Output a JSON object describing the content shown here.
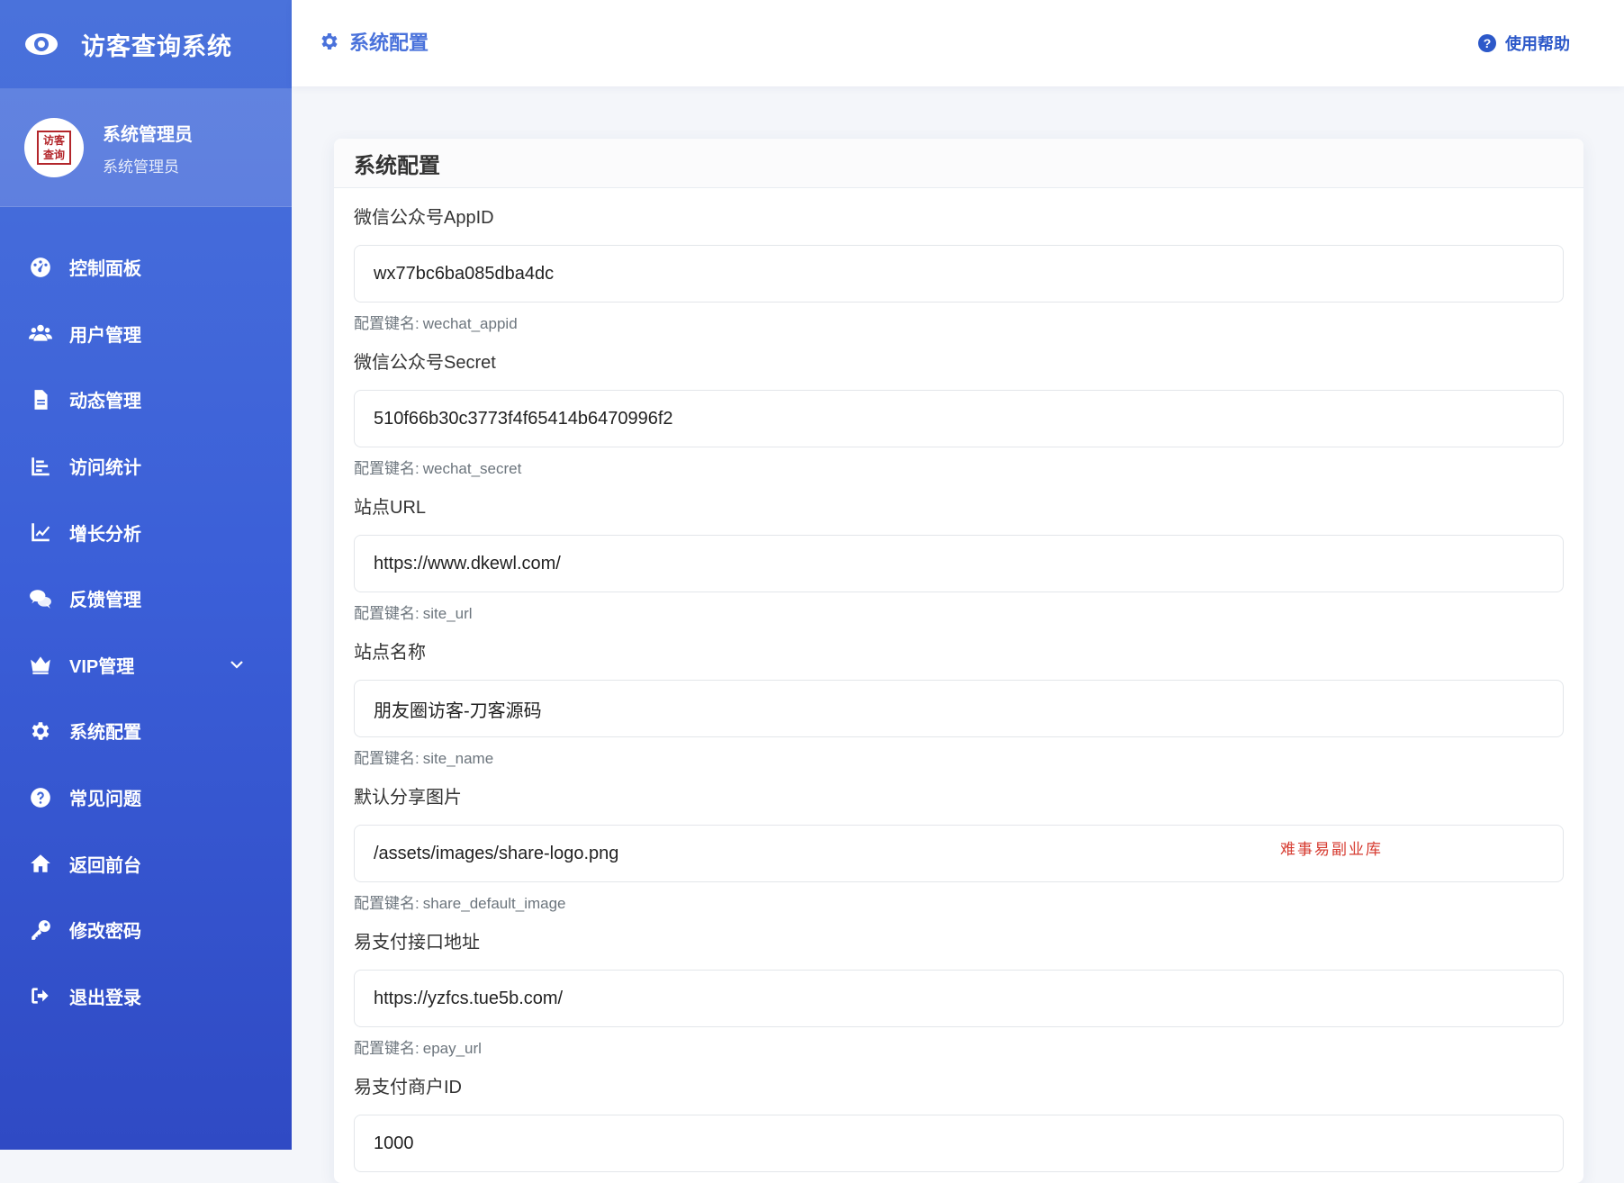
{
  "brand": {
    "title": "访客查询系统",
    "icon": "eye-icon"
  },
  "profile": {
    "name": "系统管理员",
    "role": "系统管理员",
    "avatar_text": [
      "访",
      "客",
      "查",
      "询"
    ]
  },
  "nav": [
    {
      "label": "控制面板",
      "icon": "dashboard-icon"
    },
    {
      "label": "用户管理",
      "icon": "users-icon"
    },
    {
      "label": "动态管理",
      "icon": "file-icon"
    },
    {
      "label": "访问统计",
      "icon": "bar-chart-icon"
    },
    {
      "label": "增长分析",
      "icon": "line-chart-icon"
    },
    {
      "label": "反馈管理",
      "icon": "comments-icon"
    },
    {
      "label": "VIP管理",
      "icon": "crown-icon"
    },
    {
      "label": "系统配置",
      "icon": "gear-icon"
    },
    {
      "label": "常见问题",
      "icon": "question-icon"
    },
    {
      "label": "返回前台",
      "icon": "home-icon"
    },
    {
      "label": "修改密码",
      "icon": "key-icon"
    },
    {
      "label": "退出登录",
      "icon": "logout-icon"
    }
  ],
  "topbar": {
    "title": "系统配置",
    "help_label": "使用帮助"
  },
  "card": {
    "title": "系统配置",
    "hint_prefix": "配置键名:",
    "watermark": "难事易副业库",
    "fields": [
      {
        "label": "微信公众号AppID",
        "value": "wx77bc6ba085dba4dc",
        "key": "wechat_appid"
      },
      {
        "label": "微信公众号Secret",
        "value": "510f66b30c3773f4f65414b6470996f2",
        "key": "wechat_secret"
      },
      {
        "label": "站点URL",
        "value": "https://www.dkewl.com/",
        "key": "site_url"
      },
      {
        "label": "站点名称",
        "value": "朋友圈访客-刀客源码",
        "key": "site_name"
      },
      {
        "label": "默认分享图片",
        "value": "/assets/images/share-logo.png",
        "key": "share_default_image"
      },
      {
        "label": "易支付接口地址",
        "value": "https://yzfcs.tue5b.com/",
        "key": "epay_url"
      },
      {
        "label": "易支付商户ID",
        "value": "1000",
        "key": ""
      }
    ]
  }
}
